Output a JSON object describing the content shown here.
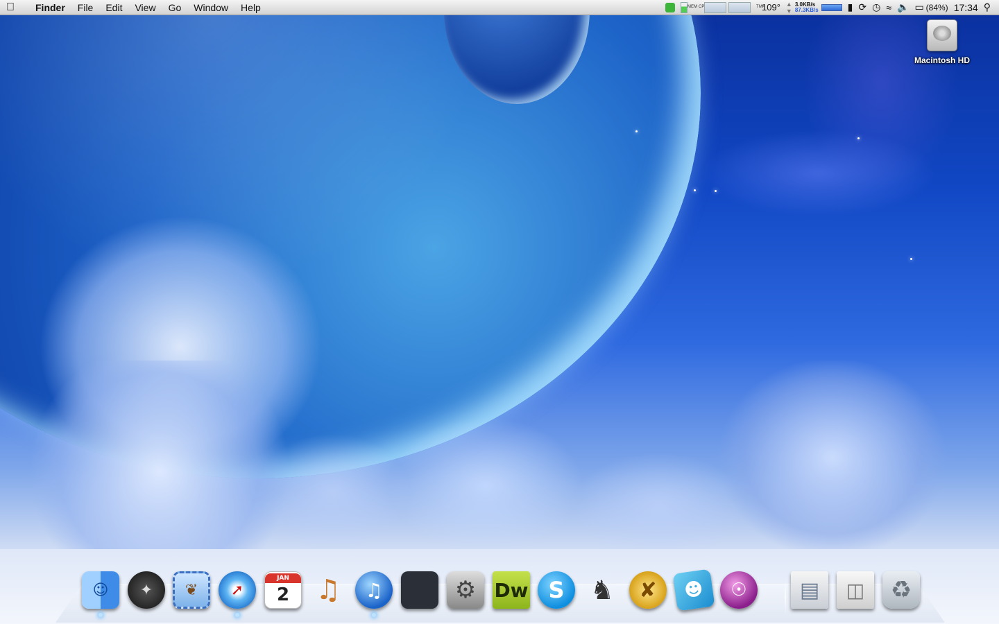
{
  "menubar": {
    "app_name": "Finder",
    "menus": [
      "File",
      "Edit",
      "View",
      "Go",
      "Window",
      "Help"
    ],
    "status": {
      "mem_label": "MEM",
      "cpu_label": "CPU",
      "tmp_label": "TMP",
      "temperature": "109°",
      "net_up": "3.0KB/s",
      "net_down": "87.3KB/s",
      "battery": "(84%)",
      "clock": "17:34"
    }
  },
  "desktop": {
    "hd_label": "Macintosh HD"
  },
  "dock": {
    "calendar_month": "JAN",
    "calendar_day": "2",
    "dreamweaver_label": "Dw",
    "skype_label": "S"
  },
  "colors": {
    "accent_blue": "#2e6ad8",
    "green_badge": "#3db53a"
  }
}
